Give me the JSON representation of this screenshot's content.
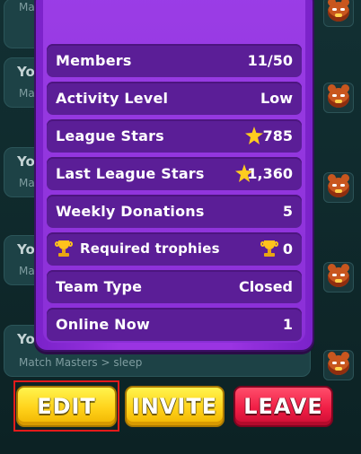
{
  "chat": {
    "messages": [
      {
        "author": "Yo",
        "text": "Ma"
      },
      {
        "author": "Yo",
        "text": "Ma"
      },
      {
        "author": "Yo",
        "text": "Ma"
      },
      {
        "author": "Yo",
        "text": "Match Masters > sleep"
      }
    ]
  },
  "team_info": {
    "rows": [
      {
        "label": "Members",
        "value": "11/50",
        "icon": ""
      },
      {
        "label": "Activity Level",
        "value": "Low",
        "icon": ""
      },
      {
        "label": "League Stars",
        "value": "785",
        "icon": "star-icon"
      },
      {
        "label": "Last League Stars",
        "value": "1,360",
        "icon": "star-icon"
      },
      {
        "label": "Weekly Donations",
        "value": "5",
        "icon": ""
      },
      {
        "label": "Required trophies",
        "value": "0",
        "icon": "trophy-icon"
      },
      {
        "label": "Team Type",
        "value": "Closed",
        "icon": ""
      },
      {
        "label": "Online Now",
        "value": "1",
        "icon": ""
      }
    ]
  },
  "actions": {
    "edit_label": "EDIT",
    "invite_label": "INVITE",
    "leave_label": "LEAVE"
  },
  "colors": {
    "panel_purple": "#9a34e2",
    "row_purple": "#5b1e97",
    "button_yellow": "#ffd21a",
    "button_red": "#f01e45",
    "highlight_red": "#e31b1b"
  }
}
